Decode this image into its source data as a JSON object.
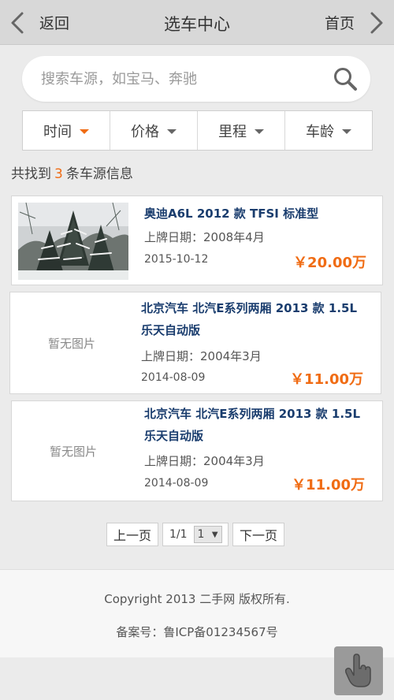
{
  "header": {
    "back_label": "返回",
    "title": "选车中心",
    "home_label": "首页"
  },
  "search": {
    "placeholder": "搜索车源，如宝马、奔驰"
  },
  "sort": {
    "items": [
      {
        "label": "时间",
        "active": true
      },
      {
        "label": "价格",
        "active": false
      },
      {
        "label": "里程",
        "active": false
      },
      {
        "label": "车龄",
        "active": false
      }
    ]
  },
  "results": {
    "prefix": "共找到",
    "count": "3",
    "suffix": "条车源信息"
  },
  "listings": [
    {
      "image": "snow-tree-photo",
      "title_line1": "奥迪A6L 2012 款 TFSI 标准型",
      "title_line2": "",
      "registered": "上牌日期：2008年4月",
      "date": "2015-10-12",
      "price": "￥20.00万"
    },
    {
      "image": "",
      "nopic_label": "暂无图片",
      "title_line1": "北京汽车 北汽E系列两厢 2013 款 1.5L",
      "title_line2": "乐天自动版",
      "registered": "上牌日期：2004年3月",
      "date": "2014-08-09",
      "price": "￥11.00万"
    },
    {
      "image": "",
      "nopic_label": "暂无图片",
      "title_line1": "北京汽车 北汽E系列两厢 2013 款 1.5L",
      "title_line2": "乐天自动版",
      "registered": "上牌日期：2004年3月",
      "date": "2014-08-09",
      "price": "￥11.00万"
    }
  ],
  "pager": {
    "prev_label": "上一页",
    "page_info": "1/1",
    "page_select": "1",
    "next_label": "下一页"
  },
  "footer": {
    "copyright": "Copyright 2013 二手网 版权所有.",
    "icp": "备案号：鲁ICP备01234567号"
  },
  "colors": {
    "accent": "#f06c14",
    "title_blue": "#1a3d6e",
    "topbar": "#d8d8d8"
  },
  "icons": [
    "chevron-left-icon",
    "chevron-right-icon",
    "search-icon",
    "caret-down-icon",
    "hand-pointer-icon"
  ]
}
